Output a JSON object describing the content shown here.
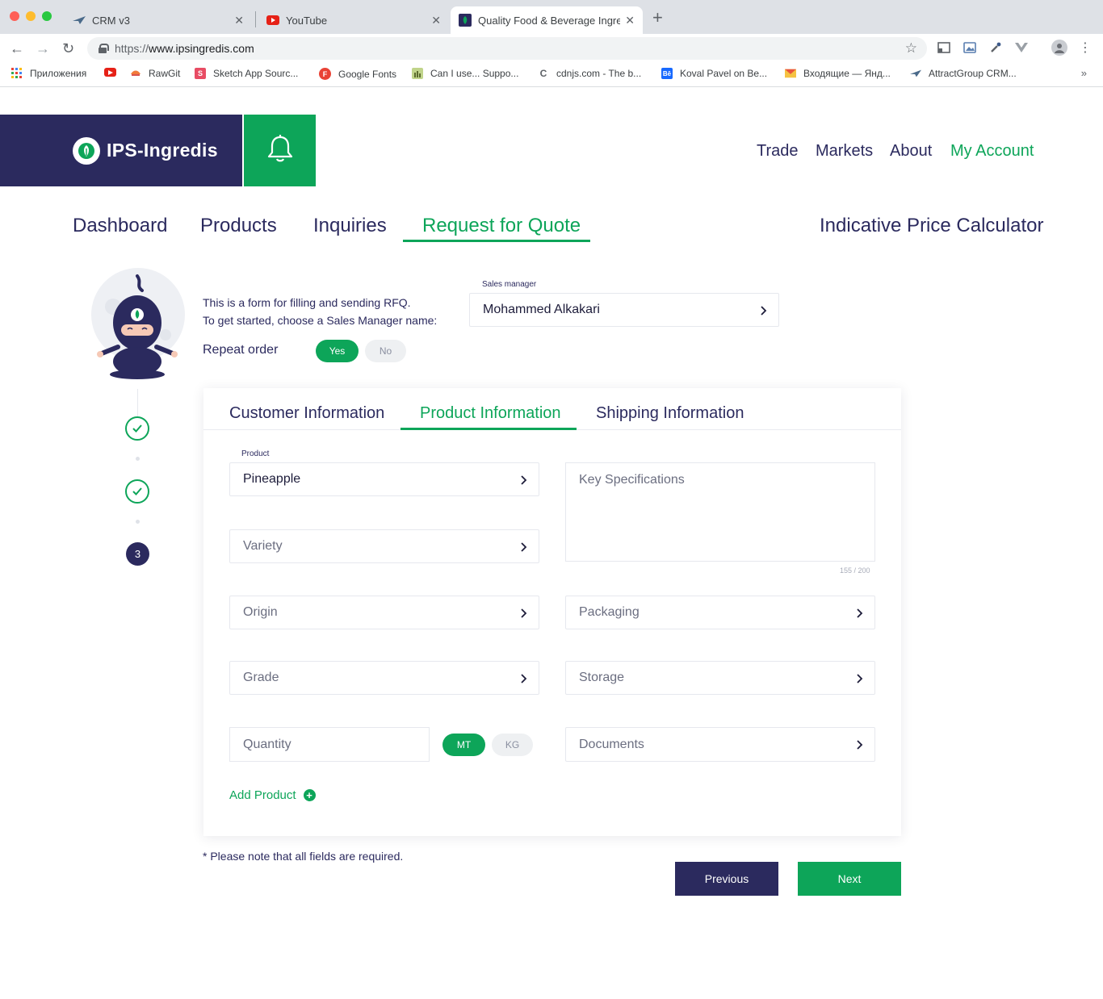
{
  "browser": {
    "tabs": [
      {
        "title": "CRM v3",
        "active": false
      },
      {
        "title": "YouTube",
        "active": false
      },
      {
        "title": "Quality Food & Beverage Ingre",
        "active": true
      }
    ],
    "url_scheme": "https://",
    "url_host": "www.ipsingredis.com",
    "bookmarks": [
      {
        "label": "Приложения",
        "icon": "apps-grid-icon"
      },
      {
        "label": "",
        "icon": "youtube-icon"
      },
      {
        "label": "RawGit",
        "icon": "rawgit-icon"
      },
      {
        "label": "Sketch App Sourc...",
        "icon": "sketch-icon"
      },
      {
        "label": "Google Fonts",
        "icon": "google-fonts-icon"
      },
      {
        "label": "Can I use... Suppo...",
        "icon": "caniuse-icon"
      },
      {
        "label": "cdnjs.com - The b...",
        "icon": "cdnjs-icon"
      },
      {
        "label": "Koval Pavel on Be...",
        "icon": "behance-icon"
      },
      {
        "label": "Входящие — Янд...",
        "icon": "mail-icon"
      },
      {
        "label": "AttractGroup CRM...",
        "icon": "attract-icon"
      }
    ],
    "bookmarks_more": "»"
  },
  "site": {
    "brand_name": "IPS-Ingredis",
    "main_nav": [
      {
        "label": "Trade",
        "active": false
      },
      {
        "label": "Markets",
        "active": false
      },
      {
        "label": "About",
        "active": false
      },
      {
        "label": "My Account",
        "active": true
      }
    ],
    "sub_nav": [
      {
        "label": "Dashboard",
        "active": false
      },
      {
        "label": "Products",
        "active": false
      },
      {
        "label": "Inquiries",
        "active": false
      },
      {
        "label": "Request for Quote",
        "active": true
      }
    ],
    "calculator_link": "Indicative Price Calculator"
  },
  "rfq": {
    "intro_line1": "This is a form for filling and sending RFQ.",
    "intro_line2": "To get started, choose a  Sales Manager name:",
    "repeat_order_label": "Repeat order",
    "repeat_yes": "Yes",
    "repeat_no": "No",
    "repeat_selected": "Yes",
    "sales_manager_label": "Sales manager",
    "sales_manager_value": "Mohammed Alkakari",
    "steps": {
      "completed": 2,
      "current": 3,
      "current_label": "3"
    }
  },
  "form": {
    "tabs": [
      {
        "label": "Customer Information",
        "active": false
      },
      {
        "label": "Product Information",
        "active": true
      },
      {
        "label": "Shipping Information",
        "active": false
      }
    ],
    "product_label": "Product",
    "product_value": "Pineapple",
    "variety_placeholder": "Variety",
    "origin_placeholder": "Origin",
    "grade_placeholder": "Grade",
    "quantity_placeholder": "Quantity",
    "unit_mt": "MT",
    "unit_kg": "KG",
    "unit_selected": "MT",
    "key_specs_placeholder": "Key Specifications",
    "key_specs_counter": "155 / 200",
    "packaging_placeholder": "Packaging",
    "storage_placeholder": "Storage",
    "documents_placeholder": "Documents",
    "add_product": "Add Product"
  },
  "footer": {
    "note": "* Please note that all fields are required.",
    "previous": "Previous",
    "next": "Next"
  },
  "colors": {
    "navy": "#2b2a5e",
    "green": "#0da559"
  }
}
